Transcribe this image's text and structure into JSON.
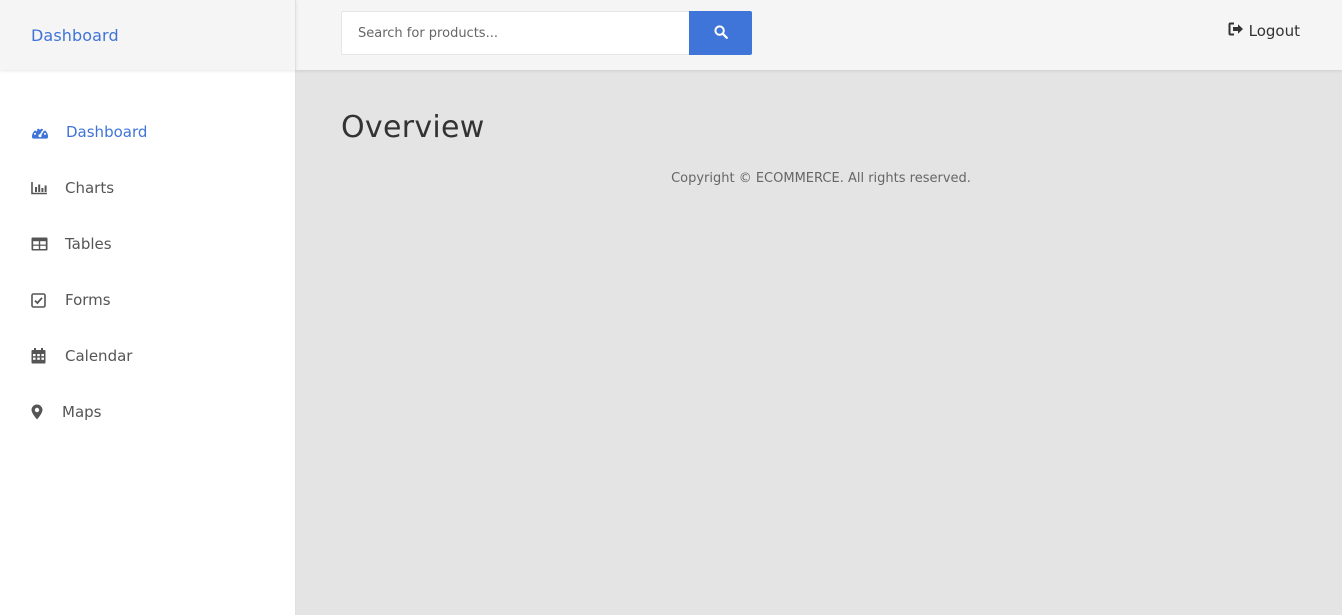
{
  "brand": {
    "label": "Dashboard"
  },
  "search": {
    "placeholder": "Search for products...",
    "icon": "search-icon"
  },
  "header": {
    "logout_label": "Logout",
    "logout_icon": "sign-out-icon"
  },
  "sidebar": {
    "items": [
      {
        "label": "Dashboard",
        "icon": "tachometer-icon",
        "active": true
      },
      {
        "label": "Charts",
        "icon": "bar-chart-icon"
      },
      {
        "label": "Tables",
        "icon": "table-icon"
      },
      {
        "label": "Forms",
        "icon": "check-square-icon"
      },
      {
        "label": "Calendar",
        "icon": "calendar-icon"
      },
      {
        "label": "Maps",
        "icon": "map-marker-icon"
      }
    ]
  },
  "main": {
    "title": "Overview",
    "footer": "Copyright © ECOMMERCE. All rights reserved."
  },
  "colors": {
    "accent": "#3f74d8",
    "content_bg": "#e4e4e4",
    "sidebar_bg": "#ffffff",
    "topbar_bg": "#f5f5f5"
  }
}
